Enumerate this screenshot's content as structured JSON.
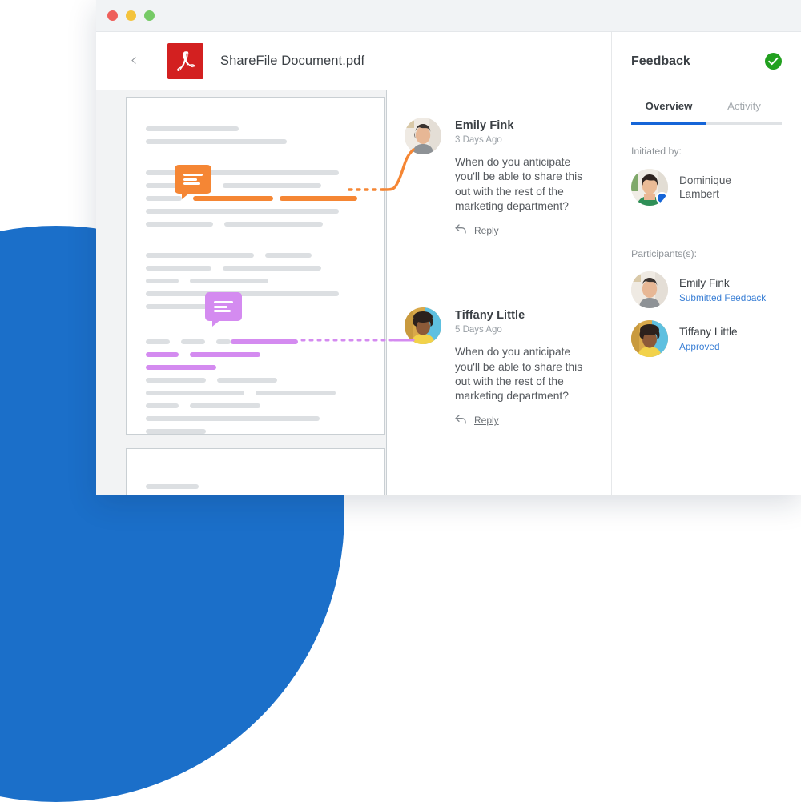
{
  "window": {
    "traffic_lights": [
      "close",
      "minimize",
      "maximize"
    ]
  },
  "doc_header": {
    "back_icon": "chevron-left-icon",
    "file_icon": "pdf-icon",
    "title": "ShareFile Document.pdf"
  },
  "document": {
    "pages": [
      {
        "id": "page-1",
        "rows": [
          {
            "type": "lines",
            "widths": [
              116
            ]
          },
          {
            "type": "lines",
            "widths": [
              176
            ]
          },
          {
            "type": "spacer"
          },
          {
            "type": "lines",
            "widths": [
              241
            ]
          },
          {
            "type": "lines",
            "widths": [
              82,
              123
            ]
          },
          {
            "type": "lines",
            "widths": [
              45,
              100,
              97
            ],
            "highlight": "orange",
            "highlight_from": 1
          },
          {
            "type": "lines",
            "widths": [
              241
            ]
          },
          {
            "type": "lines",
            "widths": [
              84,
              123
            ]
          },
          {
            "type": "spacer"
          },
          {
            "type": "lines",
            "widths": [
              135,
              58
            ]
          },
          {
            "type": "lines",
            "widths": [
              82,
              123
            ]
          },
          {
            "type": "lines",
            "widths": [
              41,
              98
            ]
          },
          {
            "type": "lines",
            "widths": [
              241
            ]
          },
          {
            "type": "lines",
            "widths": [
              84
            ]
          },
          {
            "type": "spacer"
          },
          {
            "type": "lines",
            "widths": [
              30,
              30,
              25,
              84
            ],
            "highlight": "purple",
            "highlight_from": 3
          },
          {
            "type": "lines",
            "widths": [
              41,
              88
            ],
            "highlight": "purple",
            "highlight_from": 0
          },
          {
            "type": "lines",
            "widths": [
              88
            ],
            "highlight": "purple",
            "highlight_from": 0
          },
          {
            "type": "lines",
            "widths": [
              75,
              75
            ]
          },
          {
            "type": "lines",
            "widths": [
              123,
              100
            ]
          },
          {
            "type": "lines",
            "widths": [
              41,
              88
            ]
          },
          {
            "type": "lines",
            "widths": [
              217
            ]
          },
          {
            "type": "lines",
            "widths": [
              75
            ]
          }
        ]
      },
      {
        "id": "page-2",
        "rows": [
          {
            "type": "spacer"
          },
          {
            "type": "lines",
            "widths": [
              66
            ]
          }
        ]
      }
    ],
    "markers": [
      {
        "id": "orange-comment-marker",
        "color": "#f58634"
      },
      {
        "id": "purple-comment-marker",
        "color": "#d48bf0"
      }
    ]
  },
  "comments": [
    {
      "author": "Emily Fink",
      "time": "3 Days Ago",
      "text": "When do you anticipate you'll be able to share this out with the rest of the marketing department?",
      "reply_label": "Reply",
      "reply_icon": "reply-arrow-icon",
      "accent": "#f58634"
    },
    {
      "author": "Tiffany Little",
      "time": "5 Days Ago",
      "text": "When do you anticipate you'll be able to share this out with the rest of the marketing department?",
      "reply_label": "Reply",
      "reply_icon": "reply-arrow-icon",
      "accent": "#d48bf0"
    }
  ],
  "feedback_panel": {
    "title": "Feedback",
    "badge_icon": "check-circle-icon",
    "badge_color": "#22a01f",
    "tabs": [
      {
        "label": "Overview",
        "active": true
      },
      {
        "label": "Activity",
        "active": false
      }
    ],
    "initiated_by_label": "Initiated by:",
    "initiator": {
      "name_line_1": "Dominique",
      "name_line_2": "Lambert",
      "badge": "online-dot",
      "badge_color": "#1565d8"
    },
    "participants_label": "Participants(s):",
    "participants": [
      {
        "name": "Emily Fink",
        "status": "Submitted Feedback"
      },
      {
        "name": "Tiffany Little",
        "status": "Approved"
      }
    ],
    "status_color": "#3a7fd5"
  },
  "theme": {
    "blue_circle": "#1b6fc9",
    "tab_accent": "#1565d8",
    "orange": "#f58634",
    "purple": "#d48bf0"
  }
}
